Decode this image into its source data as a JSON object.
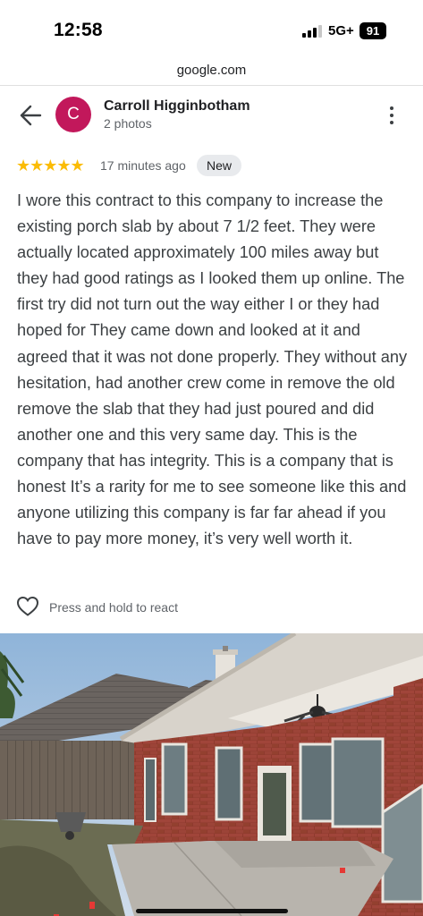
{
  "status_bar": {
    "time": "12:58",
    "network": "5G+",
    "battery": "91"
  },
  "browser": {
    "url": "google.com"
  },
  "review": {
    "reviewer_name": "Carroll Higginbotham",
    "avatar_letter": "C",
    "photo_count": "2 photos",
    "stars": 5,
    "star_glyphs": "★★★★★",
    "time_ago": "17 minutes ago",
    "badge": "New",
    "text": "I wore this contract to this company to increase the existing porch slab by about 7 1/2 feet. They were actually located approximately 100 miles away but they had good ratings as I looked them up online. The first try did not turn out the way either I or they had hoped for They came down and looked at it and agreed that it was not done properly. They without any hesitation, had another crew come in remove the old remove the slab that they had just poured and did another one and this very same day. This is the company that has integrity. This is a company that is honest It’s a rarity for me to see someone like this and anyone utilizing this company is far far ahead if you have to pay more money, it’s very well worth it.",
    "react_label": "Press and hold to react"
  },
  "colors": {
    "avatar": "#c2185b",
    "stars": "#fbbc04",
    "badge_bg": "#e8eaed"
  },
  "icons": {
    "back": "arrow-left",
    "more": "vertical-ellipsis",
    "react": "heart-outline"
  }
}
